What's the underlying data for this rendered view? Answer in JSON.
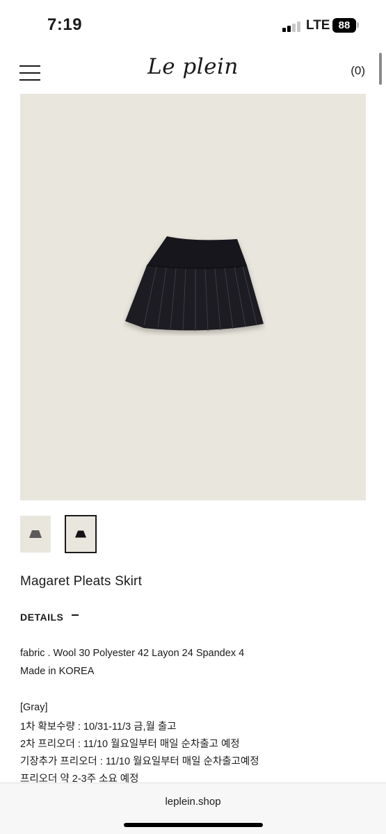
{
  "status_bar": {
    "time": "7:19",
    "network": "LTE",
    "battery": "88"
  },
  "header": {
    "logo": "Le plein",
    "cart": "(0)"
  },
  "product": {
    "name": "Magaret Pleats Skirt",
    "details_label": "DETAILS",
    "description": [
      "fabric . Wool 30 Polyester 42 Layon 24 Spandex 4",
      "Made in KOREA",
      "[Gray]",
      "1차 확보수량 : 10/31-11/3 금,월 출고",
      "2차 프리오더 : 11/10 월요일부터 매일 순차출고 예정",
      "기장추가 프리오더 : 11/10 월요일부터 매일 순차출고예정",
      "프리오더 약 2-3주 소요 예정"
    ]
  },
  "thumbnails": [
    {
      "color": "#5a5a5a",
      "selected": false
    },
    {
      "color": "#141414",
      "selected": true
    }
  ],
  "colors": {
    "image_bg": "#e9e6dd",
    "skirt": "#15171b"
  },
  "browser": {
    "url": "leplein.shop"
  }
}
